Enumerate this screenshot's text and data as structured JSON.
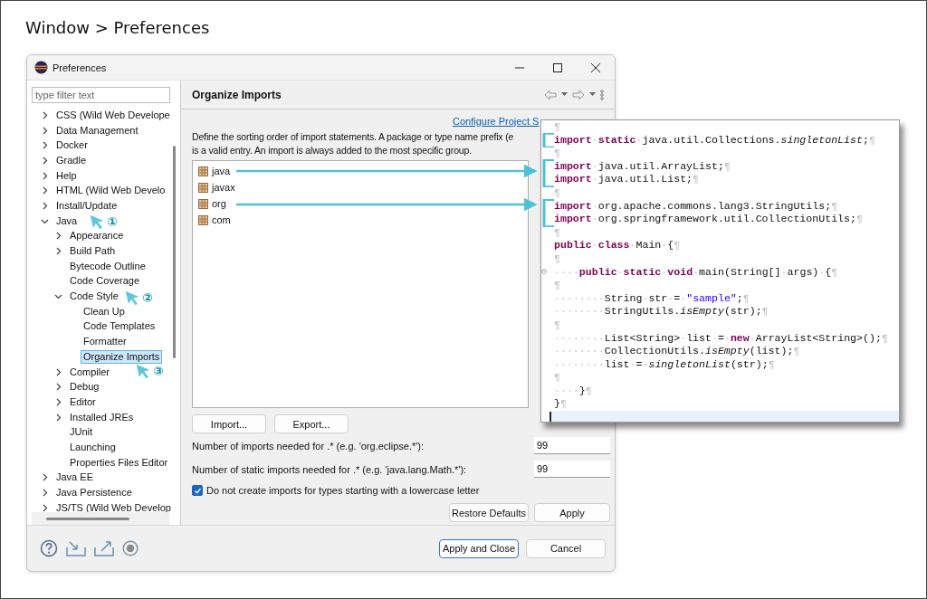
{
  "page_title": "Window > Preferences",
  "window": {
    "title": "Preferences"
  },
  "filter": {
    "placeholder": "type filter text"
  },
  "tree": [
    {
      "label": "CSS (Wild Web Develope",
      "kind": "branch",
      "expanded": false,
      "selected": false
    },
    {
      "label": "Data Management",
      "kind": "branch",
      "expanded": false,
      "selected": false
    },
    {
      "label": "Docker",
      "kind": "branch",
      "expanded": false,
      "selected": false
    },
    {
      "label": "Gradle",
      "kind": "branch",
      "expanded": false,
      "selected": false
    },
    {
      "label": "Help",
      "kind": "branch",
      "expanded": false,
      "selected": false
    },
    {
      "label": "HTML (Wild Web Develo",
      "kind": "branch",
      "expanded": false,
      "selected": false
    },
    {
      "label": "Install/Update",
      "kind": "branch",
      "expanded": false,
      "selected": false
    },
    {
      "label": "Java",
      "kind": "branch",
      "expanded": true,
      "selected": false,
      "children": [
        {
          "label": "Appearance",
          "kind": "branch",
          "expanded": false,
          "selected": false
        },
        {
          "label": "Build Path",
          "kind": "branch",
          "expanded": false,
          "selected": false
        },
        {
          "label": "Bytecode Outline",
          "kind": "leaf",
          "selected": false
        },
        {
          "label": "Code Coverage",
          "kind": "leaf",
          "selected": false
        },
        {
          "label": "Code Style",
          "kind": "branch",
          "expanded": true,
          "selected": false,
          "children": [
            {
              "label": "Clean Up",
              "kind": "leaf",
              "selected": false
            },
            {
              "label": "Code Templates",
              "kind": "leaf",
              "selected": false
            },
            {
              "label": "Formatter",
              "kind": "leaf",
              "selected": false
            },
            {
              "label": "Organize Imports",
              "kind": "leaf",
              "selected": true
            }
          ]
        },
        {
          "label": "Compiler",
          "kind": "branch",
          "expanded": false,
          "selected": false
        },
        {
          "label": "Debug",
          "kind": "branch",
          "expanded": false,
          "selected": false
        },
        {
          "label": "Editor",
          "kind": "branch",
          "expanded": false,
          "selected": false
        },
        {
          "label": "Installed JREs",
          "kind": "branch",
          "expanded": false,
          "selected": false
        },
        {
          "label": "JUnit",
          "kind": "leaf",
          "selected": false
        },
        {
          "label": "Launching",
          "kind": "leaf",
          "selected": false
        },
        {
          "label": "Properties Files Editor",
          "kind": "leaf",
          "selected": false
        }
      ]
    },
    {
      "label": "Java EE",
      "kind": "branch",
      "expanded": false,
      "selected": false
    },
    {
      "label": "Java Persistence",
      "kind": "branch",
      "expanded": false,
      "selected": false
    },
    {
      "label": "JS/TS (Wild Web Develop",
      "kind": "branch",
      "expanded": false,
      "selected": false
    }
  ],
  "page": {
    "heading": "Organize Imports",
    "link": "Configure Project S",
    "description": [
      "Define the sorting order of import statements. A package or type name prefix (e",
      "is a valid entry. An import is always added to the most specific group."
    ],
    "groups": [
      "java",
      "javax",
      "org",
      "com"
    ],
    "list_buttons": [
      "Import...",
      "Export..."
    ],
    "fields": [
      {
        "label": "Number of imports needed for .* (e.g. 'org.eclipse.*'):",
        "value": "99"
      },
      {
        "label": "Number of static imports needed for .* (e.g. 'java.lang.Math.*'):",
        "value": "99"
      }
    ],
    "checkbox": {
      "label": "Do not create imports for types starting with a lowercase letter",
      "checked": true
    },
    "page_buttons": [
      "Restore Defaults",
      "Apply"
    ]
  },
  "dialog_buttons": [
    {
      "label": "Apply and Close",
      "default": true
    },
    {
      "label": "Cancel",
      "default": false
    }
  ],
  "code_lines": [
    [
      {
        "kind": "mark",
        "text": "¶"
      }
    ],
    [
      {
        "kind": "keyword",
        "text": "import"
      },
      {
        "kind": "mark",
        "text": "·"
      },
      {
        "kind": "keyword",
        "text": "static"
      },
      {
        "kind": "mark",
        "text": "·"
      },
      {
        "kind": "plain",
        "text": "java.util.Collections."
      },
      {
        "kind": "italic",
        "text": "singletonList"
      },
      {
        "kind": "plain",
        "text": ";"
      },
      {
        "kind": "mark",
        "text": "¶"
      }
    ],
    [
      {
        "kind": "mark",
        "text": "¶"
      }
    ],
    [
      {
        "kind": "keyword",
        "text": "import"
      },
      {
        "kind": "mark",
        "text": "·"
      },
      {
        "kind": "plain",
        "text": "java.util.ArrayList;"
      },
      {
        "kind": "mark",
        "text": "¶"
      }
    ],
    [
      {
        "kind": "keyword",
        "text": "import"
      },
      {
        "kind": "mark",
        "text": "·"
      },
      {
        "kind": "plain",
        "text": "java.util.List;"
      },
      {
        "kind": "mark",
        "text": "¶"
      }
    ],
    [
      {
        "kind": "mark",
        "text": "¶"
      }
    ],
    [
      {
        "kind": "keyword",
        "text": "import"
      },
      {
        "kind": "mark",
        "text": "·"
      },
      {
        "kind": "plain",
        "text": "org.apache.commons.lang3.StringUtils;"
      },
      {
        "kind": "mark",
        "text": "¶"
      }
    ],
    [
      {
        "kind": "keyword",
        "text": "import"
      },
      {
        "kind": "mark",
        "text": "·"
      },
      {
        "kind": "plain",
        "text": "org.springframework.util.CollectionUtils;"
      },
      {
        "kind": "mark",
        "text": "¶"
      }
    ],
    [
      {
        "kind": "mark",
        "text": "¶"
      }
    ],
    [
      {
        "kind": "keyword",
        "text": "public"
      },
      {
        "kind": "mark",
        "text": "·"
      },
      {
        "kind": "keyword",
        "text": "class"
      },
      {
        "kind": "mark",
        "text": "·"
      },
      {
        "kind": "plain",
        "text": "Main"
      },
      {
        "kind": "mark",
        "text": "·"
      },
      {
        "kind": "plain",
        "text": "{"
      },
      {
        "kind": "mark",
        "text": "¶"
      }
    ],
    [
      {
        "kind": "mark",
        "text": "¶"
      }
    ],
    [
      {
        "kind": "fold",
        "text": "⊖"
      },
      {
        "kind": "mark",
        "text": "····"
      },
      {
        "kind": "keyword",
        "text": "public"
      },
      {
        "kind": "mark",
        "text": "·"
      },
      {
        "kind": "keyword",
        "text": "static"
      },
      {
        "kind": "mark",
        "text": "·"
      },
      {
        "kind": "keyword",
        "text": "void"
      },
      {
        "kind": "mark",
        "text": "·"
      },
      {
        "kind": "plain",
        "text": "main(String[]"
      },
      {
        "kind": "mark",
        "text": "·"
      },
      {
        "kind": "plain",
        "text": "args)"
      },
      {
        "kind": "mark",
        "text": "·"
      },
      {
        "kind": "plain",
        "text": "{"
      },
      {
        "kind": "mark",
        "text": "¶"
      }
    ],
    [
      {
        "kind": "mark",
        "text": "¶"
      }
    ],
    [
      {
        "kind": "mark",
        "text": "········"
      },
      {
        "kind": "plain",
        "text": "String"
      },
      {
        "kind": "mark",
        "text": "·"
      },
      {
        "kind": "plain",
        "text": "str"
      },
      {
        "kind": "mark",
        "text": "·"
      },
      {
        "kind": "plain",
        "text": "="
      },
      {
        "kind": "mark",
        "text": "·"
      },
      {
        "kind": "string",
        "text": "\"sample\""
      },
      {
        "kind": "plain",
        "text": ";"
      },
      {
        "kind": "mark",
        "text": "¶"
      }
    ],
    [
      {
        "kind": "mark",
        "text": "········"
      },
      {
        "kind": "plain",
        "text": "StringUtils."
      },
      {
        "kind": "italic",
        "text": "isEmpty"
      },
      {
        "kind": "plain",
        "text": "(str);"
      },
      {
        "kind": "mark",
        "text": "¶"
      }
    ],
    [
      {
        "kind": "mark",
        "text": "¶"
      }
    ],
    [
      {
        "kind": "mark",
        "text": "········"
      },
      {
        "kind": "plain",
        "text": "List<String>"
      },
      {
        "kind": "mark",
        "text": "·"
      },
      {
        "kind": "plain",
        "text": "list"
      },
      {
        "kind": "mark",
        "text": "·"
      },
      {
        "kind": "plain",
        "text": "="
      },
      {
        "kind": "mark",
        "text": "·"
      },
      {
        "kind": "keyword",
        "text": "new"
      },
      {
        "kind": "mark",
        "text": "·"
      },
      {
        "kind": "plain",
        "text": "ArrayList<String>();"
      },
      {
        "kind": "mark",
        "text": "¶"
      }
    ],
    [
      {
        "kind": "mark",
        "text": "········"
      },
      {
        "kind": "plain",
        "text": "CollectionUtils."
      },
      {
        "kind": "italic",
        "text": "isEmpty"
      },
      {
        "kind": "plain",
        "text": "(list);"
      },
      {
        "kind": "mark",
        "text": "¶"
      }
    ],
    [
      {
        "kind": "mark",
        "text": "········"
      },
      {
        "kind": "plain",
        "text": "list"
      },
      {
        "kind": "mark",
        "text": "·"
      },
      {
        "kind": "plain",
        "text": "="
      },
      {
        "kind": "mark",
        "text": "·"
      },
      {
        "kind": "italic",
        "text": "singletonList"
      },
      {
        "kind": "plain",
        "text": "(str);"
      },
      {
        "kind": "mark",
        "text": "¶"
      }
    ],
    [
      {
        "kind": "mark",
        "text": "¶"
      }
    ],
    [
      {
        "kind": "mark",
        "text": "····"
      },
      {
        "kind": "plain",
        "text": "}"
      },
      {
        "kind": "mark",
        "text": "¶"
      }
    ],
    [
      {
        "kind": "plain",
        "text": "}"
      },
      {
        "kind": "mark",
        "text": "¶"
      }
    ]
  ],
  "callouts": [
    "①",
    "②",
    "③"
  ]
}
